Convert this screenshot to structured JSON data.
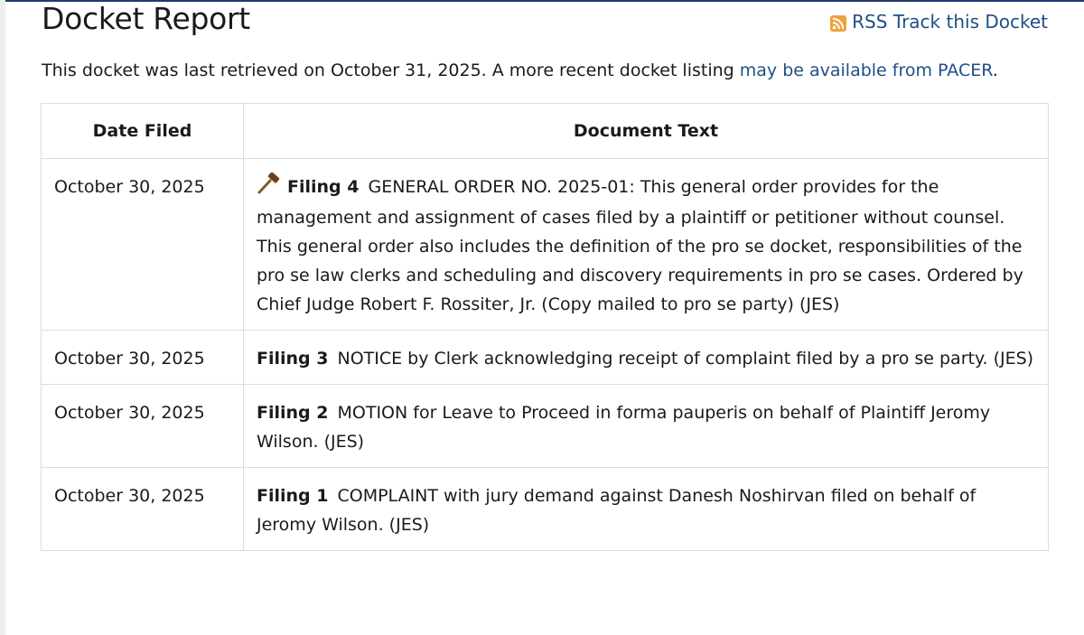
{
  "header": {
    "title": "Docket Report",
    "rss_label": "RSS Track this Docket"
  },
  "notice": {
    "prefix": "This docket was last retrieved on October 31, 2025. A more recent docket listing ",
    "link": "may be available from PACER",
    "suffix": "."
  },
  "table": {
    "headers": [
      "Date Filed",
      "Document Text"
    ],
    "rows": [
      {
        "date": "October 30, 2025",
        "filing": "Filing 4",
        "text": "GENERAL ORDER NO. 2025-01: This general order provides for the management and assignment of cases filed by a plaintiff or petitioner without counsel. This general order also includes the definition of the pro se docket, responsibilities of the pro se law clerks and scheduling and discovery requirements in pro se cases. Ordered by Chief Judge Robert F. Rossiter, Jr. (Copy mailed to pro se party) (JES)",
        "icon": "gavel-icon"
      },
      {
        "date": "October 30, 2025",
        "filing": "Filing 3",
        "text": "NOTICE by Clerk acknowledging receipt of complaint filed by a pro se party. (JES)"
      },
      {
        "date": "October 30, 2025",
        "filing": "Filing 2",
        "text": "MOTION for Leave to Proceed in forma pauperis on behalf of Plaintiff Jeromy Wilson. (JES)"
      },
      {
        "date": "October 30, 2025",
        "filing": "Filing 1",
        "text": "COMPLAINT with jury demand against Danesh Noshirvan filed on behalf of Jeromy Wilson. (JES)"
      }
    ]
  },
  "colors": {
    "link": "#1f4f86",
    "rss_orange": "#f0a23a",
    "border": "#dcdcdc",
    "gavel": "#8a5a2b"
  }
}
